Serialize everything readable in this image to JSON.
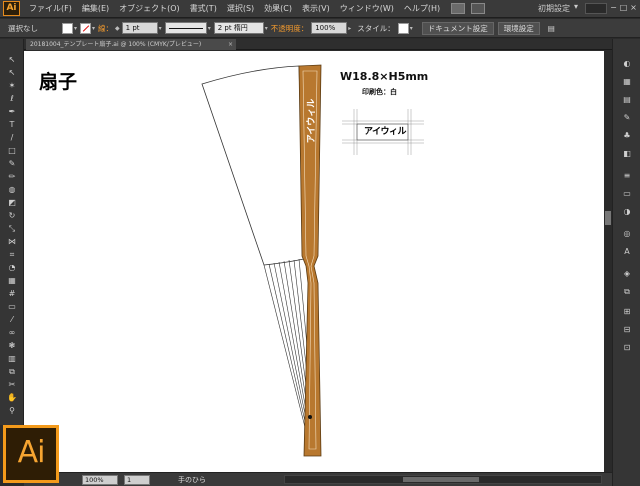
{
  "app": {
    "logo_text": "Ai",
    "brand_color": "#f39a1b"
  },
  "menu": {
    "items": [
      "ファイル(F)",
      "編集(E)",
      "オブジェクト(O)",
      "書式(T)",
      "選択(S)",
      "効果(C)",
      "表示(V)",
      "ウィンドウ(W)",
      "ヘルプ(H)"
    ],
    "workspace": "初期設定",
    "window_buttons": [
      "−",
      "□",
      "×"
    ]
  },
  "control": {
    "selection_label": "選択なし",
    "stroke_label": "線：",
    "stroke_weight": "1 pt",
    "profile_label": "均等",
    "brush_label": "2 pt 楕円",
    "opacity_label": "不透明度：",
    "opacity_value": "100%",
    "style_label": "スタイル：",
    "doc_settings_btn": "ドキュメント設定",
    "prefs_btn": "環境設定"
  },
  "document": {
    "tab_label": "20181004_テンプレート扇子.ai @ 100% (CMYK/プレビュー)",
    "tab_close": "×"
  },
  "artwork": {
    "title": "扇子",
    "size_label": "W18.8×H5mm",
    "print_color_label": "印刷色：白",
    "stick_text": "アイウィル",
    "preview_text": "アイウィル",
    "stick_color": "#b8782f"
  },
  "status": {
    "zoom": "100%",
    "page": "1",
    "tool_name": "手のひら"
  }
}
